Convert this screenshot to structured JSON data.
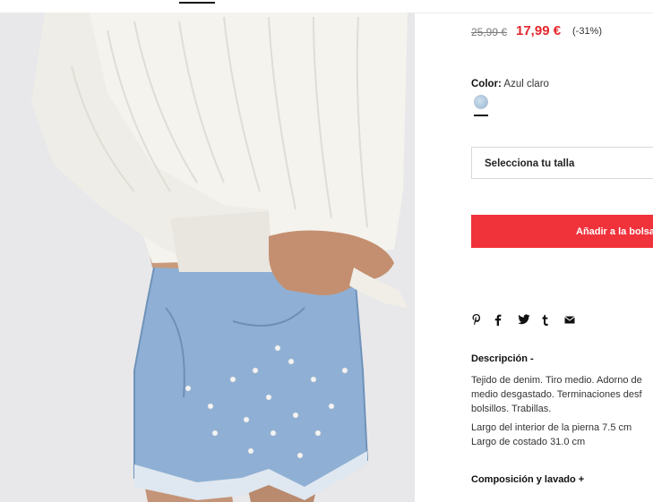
{
  "price": {
    "old": "25,99 €",
    "new": "17,99 €",
    "discount": "(-31%)"
  },
  "color": {
    "label": "Color:",
    "value": "Azul claro",
    "swatch_hex": "#a9c3dc"
  },
  "size_select": {
    "placeholder": "Selecciona tu talla"
  },
  "add_button": {
    "label": "Añadir a la bolsa"
  },
  "share_icons": [
    "pinterest-icon",
    "facebook-icon",
    "twitter-icon",
    "tumblr-icon",
    "email-icon"
  ],
  "description": {
    "title": "Descripción -",
    "text": "Tejido de denim. Tiro medio. Adorno de\nmedio desgastado. Terminaciones desf\nbolsillos. Trabillas.",
    "measure_inseam": "Largo del interior de la pierna 7.5 cm",
    "measure_side": "Largo de costado 31.0 cm"
  },
  "composition": {
    "title": "Composición y lavado +"
  },
  "colors": {
    "accent": "#f0323b",
    "sale_price": "#e4262c"
  }
}
